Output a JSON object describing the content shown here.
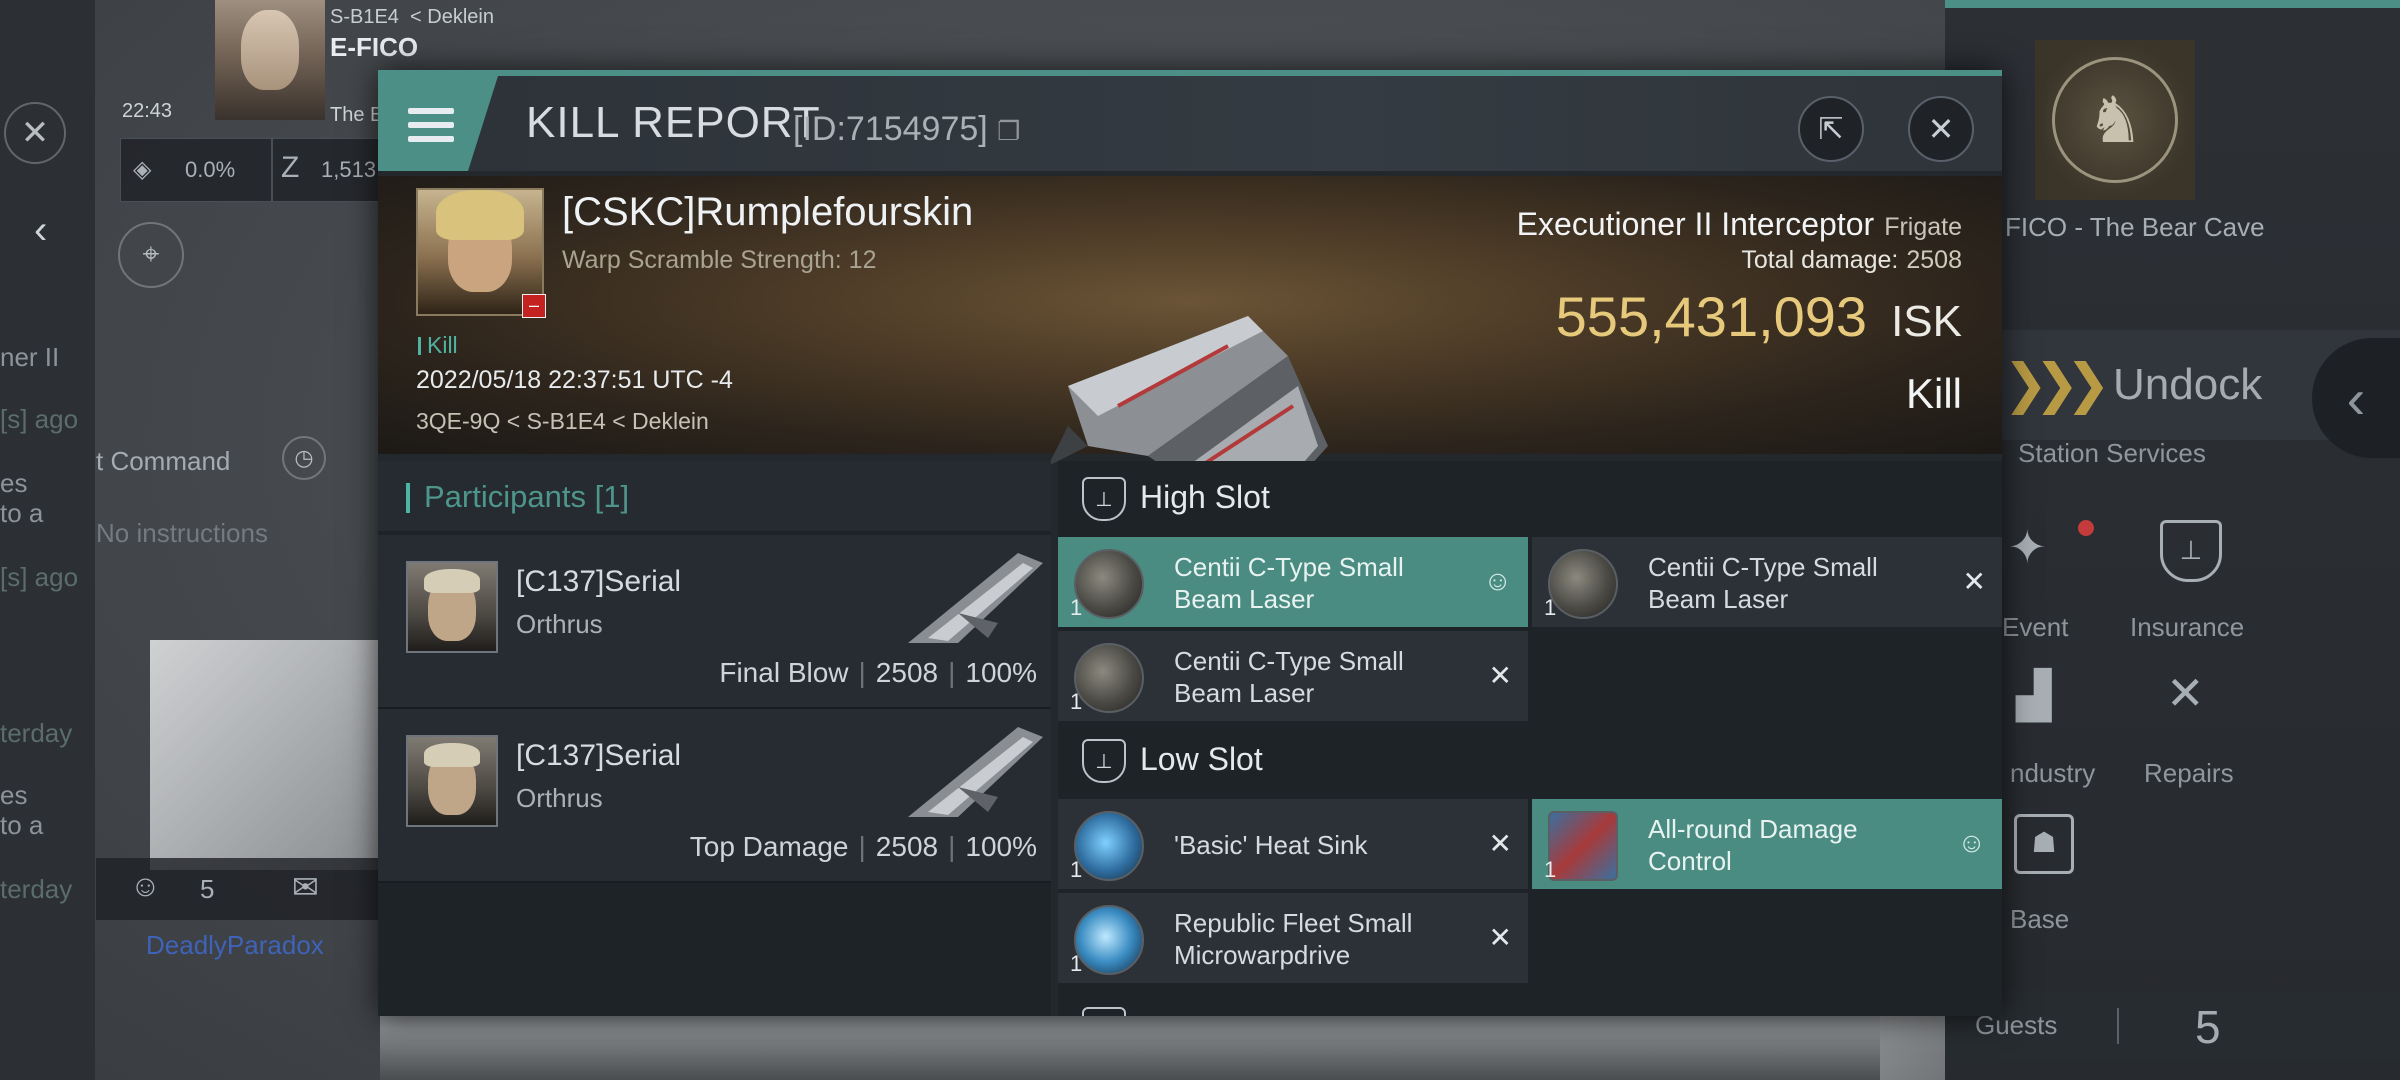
{
  "background": {
    "pilot": {
      "system": "S-B1E4",
      "region": "Deklein",
      "name": "E-FICO",
      "time": "22:43",
      "corp_short": "The B"
    },
    "stats": {
      "cargo": "0.0%",
      "balance": "1,513"
    },
    "left_labels": [
      "ner II",
      "[s] ago",
      "es",
      "to a",
      "[s] ago",
      "terday",
      "es",
      "to a",
      "terday"
    ],
    "fleet_command": "t Command",
    "instructions": "No instructions",
    "chat_count": "5",
    "chat_user": "DeadlyParadox",
    "station_name": "FICO - The Bear Cave",
    "undock": "Undock",
    "station_services": "Station Services",
    "services": [
      {
        "label": "Event",
        "icon": "party-popper-icon"
      },
      {
        "label": "Insurance",
        "icon": "insurance-shield-icon"
      },
      {
        "label": "ndustry",
        "icon": "factory-icon"
      },
      {
        "label": "Repairs",
        "icon": "wrench-icon"
      },
      {
        "label": "Base",
        "icon": "base-icon"
      }
    ],
    "guests_label": "Guests",
    "guests_count": "5"
  },
  "modal": {
    "title": "KILL REPORT",
    "id": "[ID:7154975]",
    "victim": {
      "name": "[CSKC]Rumplefourskin",
      "warp_scramble": "Warp Scramble Strength: 12",
      "kill_tag": "Kill",
      "time": "2022/05/18 22:37:51 UTC -4",
      "location": "3QE-9Q < S-B1E4 < Deklein"
    },
    "ship": {
      "name": "Executioner II Interceptor",
      "class": "Frigate",
      "total_damage_label": "Total damage:",
      "total_damage": "2508",
      "isk_value": "555,431,093",
      "isk_unit": "ISK",
      "result": "Kill"
    },
    "participants": {
      "title": "Participants",
      "count": "[1]",
      "rows": [
        {
          "name": "[C137]Serial",
          "ship": "Orthrus",
          "role": "Final Blow",
          "damage": "2508",
          "percent": "100%"
        },
        {
          "name": "[C137]Serial",
          "ship": "Orthrus",
          "role": "Top Damage",
          "damage": "2508",
          "percent": "100%"
        }
      ]
    },
    "high_slot": {
      "title": "High Slot",
      "modules": [
        {
          "name": "Centii C-Type Small Beam Laser",
          "qty": "1",
          "state": "pilot-icon"
        },
        {
          "name": "Centii C-Type Small Beam Laser",
          "qty": "1",
          "state": "destroyed-icon"
        },
        {
          "name": "Centii C-Type Small Beam Laser",
          "qty": "1",
          "state": "destroyed-icon"
        }
      ]
    },
    "low_slot": {
      "title": "Low Slot",
      "modules": [
        {
          "name": "'Basic' Heat Sink",
          "qty": "1",
          "state": "destroyed-icon"
        },
        {
          "name": "All-round Damage Control",
          "qty": "1",
          "state": "pilot-icon"
        },
        {
          "name": "Republic Fleet Small Microwarpdrive",
          "qty": "1",
          "state": "destroyed-icon"
        }
      ]
    },
    "colors": {
      "accent": "#4b8f86",
      "isk": "#e7c97c",
      "kill_tag": "#4fb3a4"
    }
  }
}
